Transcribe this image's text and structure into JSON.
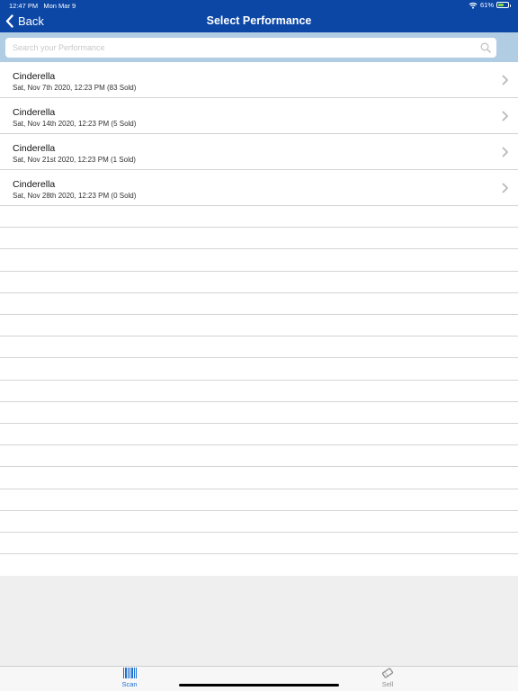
{
  "status_bar": {
    "time": "12:47 PM",
    "date": "Mon Mar 9",
    "battery": "61%",
    "battery_level": 0.61
  },
  "nav": {
    "back_label": "Back",
    "title": "Select Performance"
  },
  "search": {
    "placeholder": "Search your Performance",
    "value": ""
  },
  "performances": [
    {
      "name": "Cinderella",
      "detail": "Sat, Nov 7th 2020, 12:23 PM (83 Sold)"
    },
    {
      "name": "Cinderella",
      "detail": "Sat, Nov 14th 2020, 12:23 PM (5 Sold)"
    },
    {
      "name": "Cinderella",
      "detail": "Sat, Nov 21st 2020, 12:23 PM (1 Sold)"
    },
    {
      "name": "Cinderella",
      "detail": "Sat, Nov 28th 2020, 12:23 PM (0 Sold)"
    }
  ],
  "tabs": [
    {
      "label": "Scan",
      "icon": "barcode-icon",
      "active": true
    },
    {
      "label": "Sell",
      "icon": "ticket-icon",
      "active": false
    }
  ],
  "colors": {
    "header": "#0c47a6",
    "search_band": "#b1cde4",
    "active_tab": "#1f6fd1",
    "inactive_tab": "#8e8e8e",
    "battery": "#7cd94b"
  }
}
